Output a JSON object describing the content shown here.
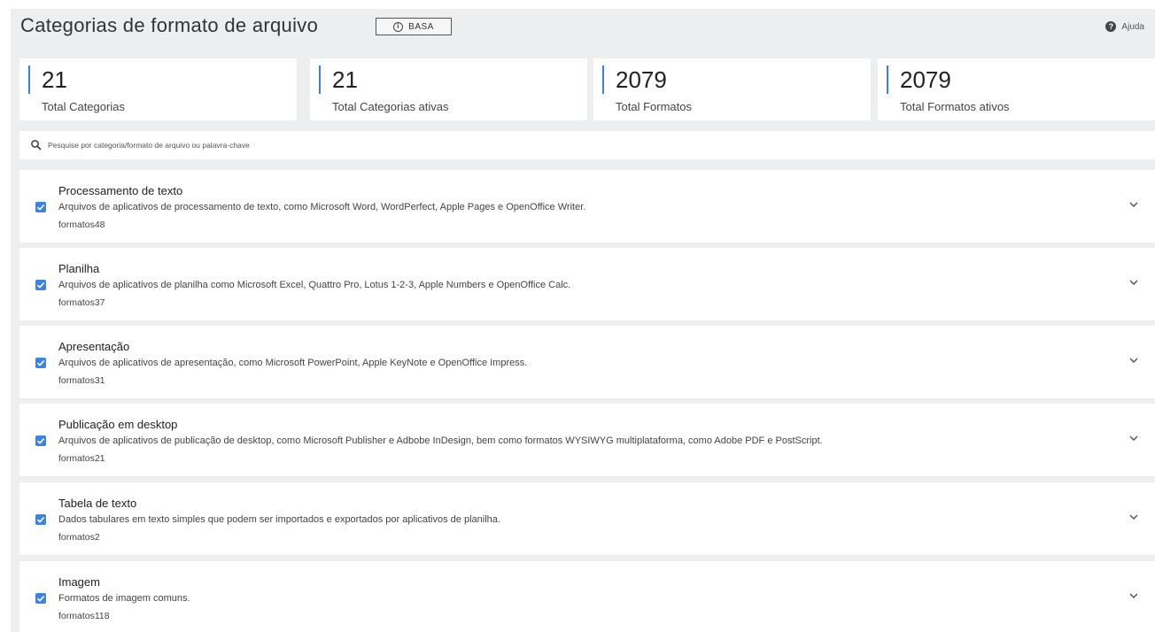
{
  "header": {
    "title": "Categorias de formato de arquivo",
    "badge": "BASA",
    "help_label": "Ajuda"
  },
  "stats": [
    {
      "value": "21",
      "label": "Total Categorias"
    },
    {
      "value": "21",
      "label": "Total Categorias ativas"
    },
    {
      "value": "2079",
      "label": "Total Formatos"
    },
    {
      "value": "2079",
      "label": "Total Formatos ativos"
    }
  ],
  "search": {
    "placeholder": "Pesquise por categoria/formato de arquivo ou palavra-chave",
    "value": ""
  },
  "categories": [
    {
      "title": "Processamento de texto",
      "description": "Arquivos de aplicativos de processamento de texto, como Microsoft Word, WordPerfect, Apple Pages e OpenOffice Writer.",
      "count": "formatos48",
      "checked": true
    },
    {
      "title": "Planilha",
      "description": "Arquivos de aplicativos de planilha como Microsoft Excel, Quattro Pro, Lotus 1-2-3, Apple Numbers e OpenOffice Calc.",
      "count": "formatos37",
      "checked": true
    },
    {
      "title": "Apresentação",
      "description": "Arquivos de aplicativos de apresentação, como Microsoft PowerPoint, Apple KeyNote e OpenOffice Impress.",
      "count": "formatos31",
      "checked": true
    },
    {
      "title": "Publicação em desktop",
      "description": "Arquivos de aplicativos de publicação de desktop, como Microsoft Publisher e Adbobe InDesign, bem como formatos WYSIWYG multiplataforma, como Adobe PDF e PostScript.",
      "count": "formatos21",
      "checked": true
    },
    {
      "title": "Tabela de texto",
      "description": "Dados tabulares em texto simples que podem ser importados e exportados por aplicativos de planilha.",
      "count": "formatos2",
      "checked": true
    },
    {
      "title": "Imagem",
      "description": "Formatos de imagem comuns.",
      "count": "formatos118",
      "checked": true
    }
  ],
  "colors": {
    "accent": "#3f84d9",
    "page_background": "#eceeef",
    "card_background": "#ffffff"
  },
  "icons": {
    "badge": "info-icon",
    "help": "question-circle-icon",
    "search": "search-icon",
    "checkbox": "checkbox-checked-icon",
    "expand": "chevron-down-icon"
  }
}
